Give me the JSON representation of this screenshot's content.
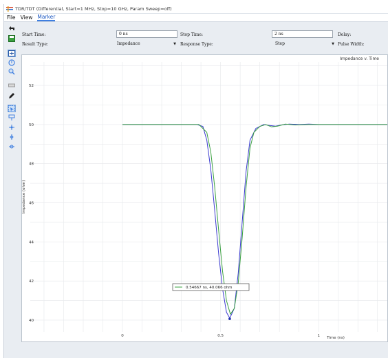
{
  "window": {
    "title": "TDR/TDT (Differential, Start=1 MHz, Stop=10 GHz, Param Sweep=off)"
  },
  "menu": [
    "File",
    "View",
    "Marker"
  ],
  "toolbar": {
    "tools": [
      "back-arrow-icon",
      "save-icon",
      "fit-icon",
      "pan-hand-icon",
      "zoom-icon",
      "eraser-icon",
      "pen-icon",
      "select-pointer-icon",
      "marker-flag-icon",
      "marker-plus-icon",
      "marker-diamond-icon",
      "marker-double-icon"
    ]
  },
  "form": {
    "start_time_label": "Start Time:",
    "start_time_value": "0 ns",
    "stop_time_label": "Stop Time:",
    "stop_time_value": "2 ns",
    "delay_label": "Delay:",
    "result_type_label": "Result Type:",
    "result_type_value": "Impedance",
    "response_type_label": "Response Type:",
    "response_type_value": "Step",
    "pulse_width_label": "Pulse Width:"
  },
  "chart_data": {
    "type": "line",
    "title": "Impedance v. Time",
    "xlabel": "Time (ns)",
    "ylabel": "Impedance (ohm)",
    "xlim": [
      -0.47,
      1.35
    ],
    "ylim": [
      39.4,
      53.2
    ],
    "xticks": [
      0,
      0.5,
      1
    ],
    "yticks": [
      40,
      42,
      44,
      46,
      48,
      50,
      52
    ],
    "grid": true,
    "series": [
      {
        "color": "#3a3ad0",
        "x": [
          0,
          0.38,
          0.41,
          0.43,
          0.45,
          0.47,
          0.49,
          0.51,
          0.53,
          0.547,
          0.57,
          0.59,
          0.61,
          0.63,
          0.65,
          0.68,
          0.72,
          0.75,
          0.78,
          0.81,
          0.85,
          0.9,
          0.95,
          1.0,
          1.35
        ],
        "y": [
          50.0,
          50.0,
          49.9,
          49.2,
          47.7,
          45.6,
          43.4,
          41.6,
          40.4,
          40.1,
          40.6,
          42.4,
          45.0,
          47.6,
          49.2,
          49.8,
          50.0,
          49.95,
          49.92,
          49.98,
          50.02,
          50.0,
          50.02,
          50.0,
          50.0
        ]
      },
      {
        "color": "#3aa040",
        "x": [
          0,
          0.39,
          0.43,
          0.45,
          0.47,
          0.49,
          0.51,
          0.53,
          0.55,
          0.57,
          0.59,
          0.61,
          0.63,
          0.65,
          0.67,
          0.7,
          0.73,
          0.76,
          0.79,
          0.83,
          0.88,
          0.95,
          1.0,
          1.35
        ],
        "y": [
          50.0,
          50.0,
          49.6,
          48.6,
          46.8,
          44.6,
          42.5,
          41.0,
          40.3,
          40.6,
          41.9,
          44.2,
          46.8,
          48.8,
          49.6,
          49.9,
          50.0,
          49.88,
          49.92,
          50.02,
          49.98,
          50.0,
          50.0,
          50.0
        ]
      }
    ],
    "marker": {
      "x": 0.54667,
      "y": 40.066,
      "label": "0.54667 ns, 40.066 ohm"
    }
  }
}
